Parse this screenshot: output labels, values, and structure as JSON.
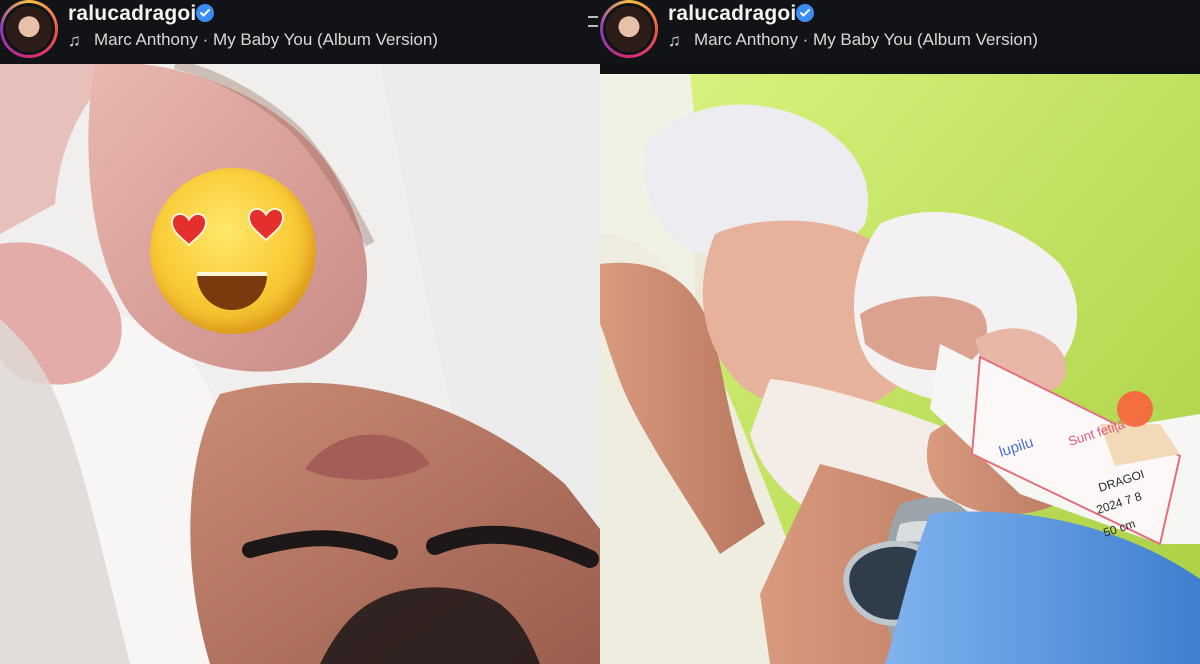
{
  "panels": [
    {
      "username": "ralucadragoi",
      "track": "Marc Anthony · My Baby You (Album Version)",
      "verified_icon": "verified-badge-icon",
      "music_icon": "music-note-icon"
    },
    {
      "username": "ralucadragoi",
      "track": "Marc Anthony · My Baby You (Album Version)",
      "verified_icon": "verified-badge-icon",
      "music_icon": "music-note-icon"
    }
  ],
  "colors": {
    "verified": "#3a8df2",
    "header": "#121317",
    "scrub": "#f3c63a"
  }
}
